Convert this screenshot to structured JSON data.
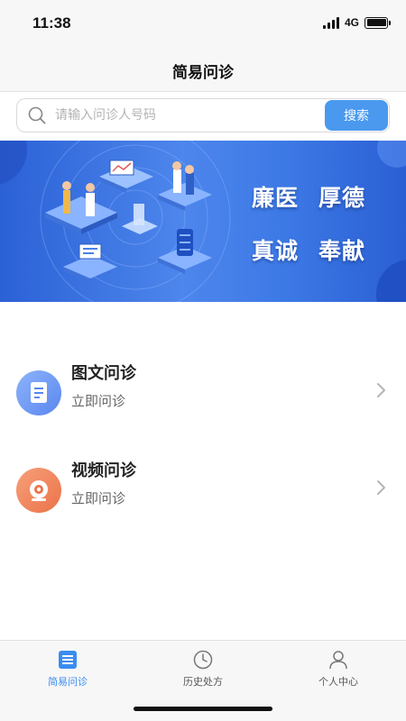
{
  "status_bar": {
    "time": "11:38",
    "network": "4G"
  },
  "nav": {
    "title": "简易问诊"
  },
  "search": {
    "placeholder": "请输入问诊人号码",
    "value": "",
    "button_label": "搜索"
  },
  "banner": {
    "slogans": [
      "廉医",
      "厚德",
      "真诚",
      "奉献"
    ]
  },
  "services": [
    {
      "title": "图文问诊",
      "subtitle": "立即问诊",
      "icon": "document-icon",
      "color": "#6b95f2"
    },
    {
      "title": "视频问诊",
      "subtitle": "立即问诊",
      "icon": "camera-icon",
      "color": "#f0815a"
    }
  ],
  "tabbar": {
    "items": [
      {
        "label": "简易问诊",
        "icon": "list-icon",
        "active": true
      },
      {
        "label": "历史处方",
        "icon": "clock-icon",
        "active": false
      },
      {
        "label": "个人中心",
        "icon": "person-icon",
        "active": false
      }
    ]
  },
  "colors": {
    "accent": "#3b8cf0",
    "search_button": "#4a99ef",
    "banner": "#3a73e2"
  }
}
